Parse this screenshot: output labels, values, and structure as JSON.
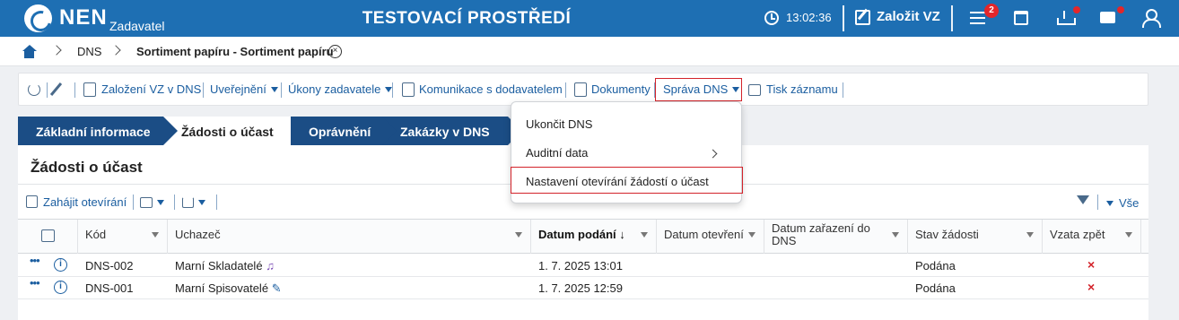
{
  "topbar": {
    "brand": "NEN",
    "brand_sub": "Zadavatel",
    "env_title": "TESTOVACÍ PROSTŘEDÍ",
    "time": "13:02:36",
    "new_label": "Založit VZ",
    "menu_badge": "2",
    "icons": [
      "nen-logo-icon",
      "clock-icon",
      "new-document-icon",
      "menu-icon",
      "calendar-icon",
      "download-icon",
      "mail-icon",
      "user-icon"
    ],
    "accent_color": "#1e6fb3",
    "badge_color": "#e3262a"
  },
  "breadcrumb": {
    "items": [
      "DNS",
      "Sortiment papíru - Sortiment papíru"
    ],
    "close_symbol": "×"
  },
  "toolbar": {
    "items": [
      {
        "label": "Založení VZ v DNS"
      },
      {
        "label": "Uveřejnění"
      },
      {
        "label": "Úkony zadavatele"
      },
      {
        "label": "Komunikace s dodavatelem"
      },
      {
        "label": "Dokumenty"
      },
      {
        "label": "Správa DNS"
      },
      {
        "label": "Tisk záznamu"
      }
    ]
  },
  "tabs": [
    {
      "label": "Základní informace"
    },
    {
      "label": "Žádosti o účast"
    },
    {
      "label": "Oprávnění"
    },
    {
      "label": "Zakázky v DNS"
    }
  ],
  "panel": {
    "title": "Žádosti o účast",
    "start_opening": "Zahájit otevírání",
    "filter_all": "Vše"
  },
  "grid": {
    "columns": [
      "Kód",
      "Uchazeč",
      "Datum podání",
      "Datum otevření",
      "Datum zařazení do DNS",
      "Stav žádosti",
      "Vzata zpět"
    ],
    "rows": [
      {
        "code": "DNS-002",
        "applicant": "Marní Skladatelé",
        "applicant_icon": "music-note-icon",
        "submitted": "1. 7. 2025 13:01",
        "opened": "",
        "included": "",
        "status": "Podána",
        "withdrawn": "×"
      },
      {
        "code": "DNS-001",
        "applicant": "Marní Spisovatelé",
        "applicant_icon": "pen-icon",
        "submitted": "1. 7. 2025 12:59",
        "opened": "",
        "included": "",
        "status": "Podána",
        "withdrawn": "×"
      }
    ]
  },
  "dropdown": {
    "items": [
      {
        "label": "Ukončit DNS"
      },
      {
        "label": "Auditní data"
      },
      {
        "label": "Nastavení otevírání žádostí o účast"
      }
    ]
  }
}
